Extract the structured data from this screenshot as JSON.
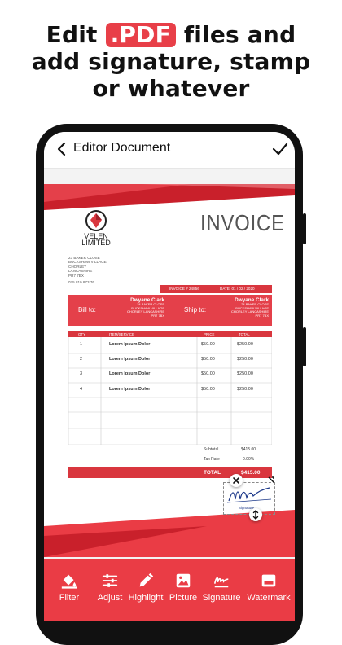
{
  "headline": {
    "line1_before": "Edit",
    "line1_badge": ".PDF",
    "line1_after": "files and",
    "line2": "add signature, stamp",
    "line3": "or whatever"
  },
  "appbar": {
    "title": "Editor Document"
  },
  "invoice": {
    "logo_line1": "VELEN",
    "logo_line2": "LIMITED",
    "heading": "INVOICE",
    "address": [
      "23 BAKER CLOSE",
      "BUCKSHAW VILLAGE",
      "CHORLEY",
      "LANCASHIRE",
      "PR7 7BX"
    ],
    "phone": "075 810 873 76",
    "invoice_no": "INVOICE # 24856",
    "date": "DATE: 01 / 02 / 2020",
    "bill_to_label": "Bill to:",
    "ship_to_label": "Ship to:",
    "bill_to": {
      "name": "Dwyane Clark",
      "lines": [
        "24 BAKER CLOSE",
        "BUCKSHAW VILLAGE",
        "CHORLEY LANCASHIRE",
        "PR7 7BX"
      ]
    },
    "ship_to": {
      "name": "Dwyane Clark",
      "lines": [
        "24 BAKER CLOSE",
        "BUCKSHAW VILLAGE",
        "CHORLEY LANCASHIRE",
        "PR7 7BX"
      ]
    },
    "columns": [
      "QTY",
      "ITEM/SERVICE",
      "PRICE",
      "TOTAL"
    ],
    "rows": [
      {
        "qty": "1",
        "item": "Lorem Ipsum Dolor",
        "price": "$50.00",
        "total": "$250.00"
      },
      {
        "qty": "2",
        "item": "Lorem Ipsum Dolor",
        "price": "$50.00",
        "total": "$250.00"
      },
      {
        "qty": "3",
        "item": "Lorem Ipsum Dolor",
        "price": "$50.00",
        "total": "$250.00"
      },
      {
        "qty": "4",
        "item": "Lorem Ipsum Dolor",
        "price": "$50.00",
        "total": "$250.00"
      }
    ],
    "subtotal_label": "Subtotal",
    "subtotal_value": "$415.00",
    "tax_label": "Tax Rate",
    "tax_value": "0.00%",
    "total_label": "TOTAL",
    "total_value": "$415.00",
    "signature_caption": "Signature"
  },
  "toolbar": {
    "items": [
      {
        "label": "Filter",
        "icon": "paint-bucket-icon"
      },
      {
        "label": "Adjust",
        "icon": "sliders-icon"
      },
      {
        "label": "Highlight",
        "icon": "pencil-icon"
      },
      {
        "label": "Picture",
        "icon": "image-icon"
      },
      {
        "label": "Signature",
        "icon": "signature-icon"
      },
      {
        "label": "Watermark",
        "icon": "watermark-icon"
      }
    ]
  },
  "colors": {
    "accent": "#ea3c45",
    "invoice_red": "#d9363e"
  }
}
